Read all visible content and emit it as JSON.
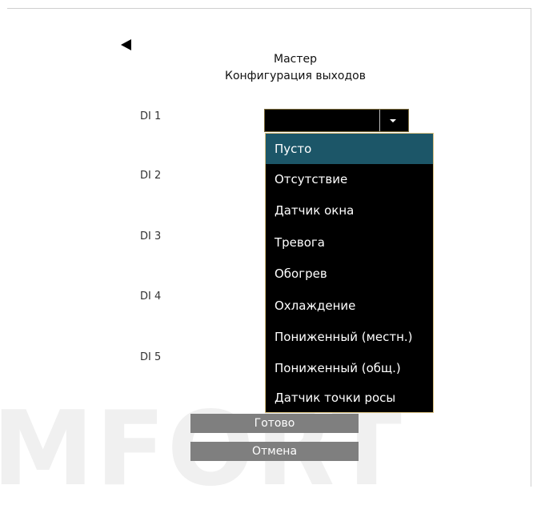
{
  "watermark": "MFORT",
  "header": {
    "title": "Мастер",
    "subtitle": "Конфигурация выходов"
  },
  "inputs": [
    {
      "label": "DI 1"
    },
    {
      "label": "DI 2"
    },
    {
      "label": "DI 3"
    },
    {
      "label": "DI 4"
    },
    {
      "label": "DI 5"
    }
  ],
  "select": {
    "value": "",
    "options": [
      "Пусто",
      "Отсутствие",
      "Датчик окна",
      "Тревога",
      "Обогрев",
      "Охлаждение",
      "Пониженный (местн.)",
      "Пониженный (общ.)",
      "Датчик точки росы"
    ],
    "highlighted": "Пусто"
  },
  "buttons": {
    "done": "Готово",
    "cancel": "Отмена"
  },
  "colors": {
    "highlight": "#1c5668",
    "dropdown_bg": "#000000",
    "button_bg": "#7f7f7f"
  }
}
